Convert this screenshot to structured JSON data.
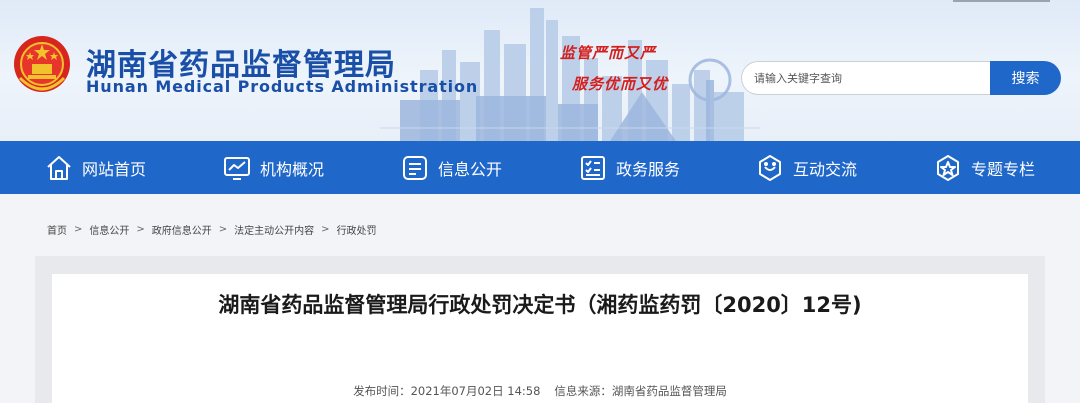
{
  "header": {
    "title_cn": "湖南省药品监督管理局",
    "title_en": "Hunan Medical Products Administration",
    "slogan_line1": "监管严而又严",
    "slogan_line2": "服务优而又优"
  },
  "search": {
    "placeholder": "请输入关键字查询",
    "button_label": "搜索"
  },
  "nav": {
    "items": [
      {
        "label": "网站首页",
        "icon": "home-icon"
      },
      {
        "label": "机构概况",
        "icon": "monitor-chart-icon"
      },
      {
        "label": "信息公开",
        "icon": "info-document-icon"
      },
      {
        "label": "政务服务",
        "icon": "checklist-icon"
      },
      {
        "label": "互动交流",
        "icon": "chat-bubble-icon"
      },
      {
        "label": "专题专栏",
        "icon": "badge-star-icon"
      }
    ]
  },
  "breadcrumb": {
    "items": [
      "首页",
      "信息公开",
      "政府信息公开",
      "法定主动公开内容",
      "行政处罚"
    ],
    "separator": ">"
  },
  "article": {
    "title": "湖南省药品监督管理局行政处罚决定书（湘药监药罚〔2020〕12号)",
    "publish_label": "发布时间：",
    "publish_time": "2021年07月02日 14:58",
    "source_label": "信息来源：",
    "source": "湖南省药品监督管理局"
  },
  "colors": {
    "brand_blue": "#1f67c9",
    "title_blue": "#1a4fa8",
    "slogan_red": "#d3201f"
  }
}
